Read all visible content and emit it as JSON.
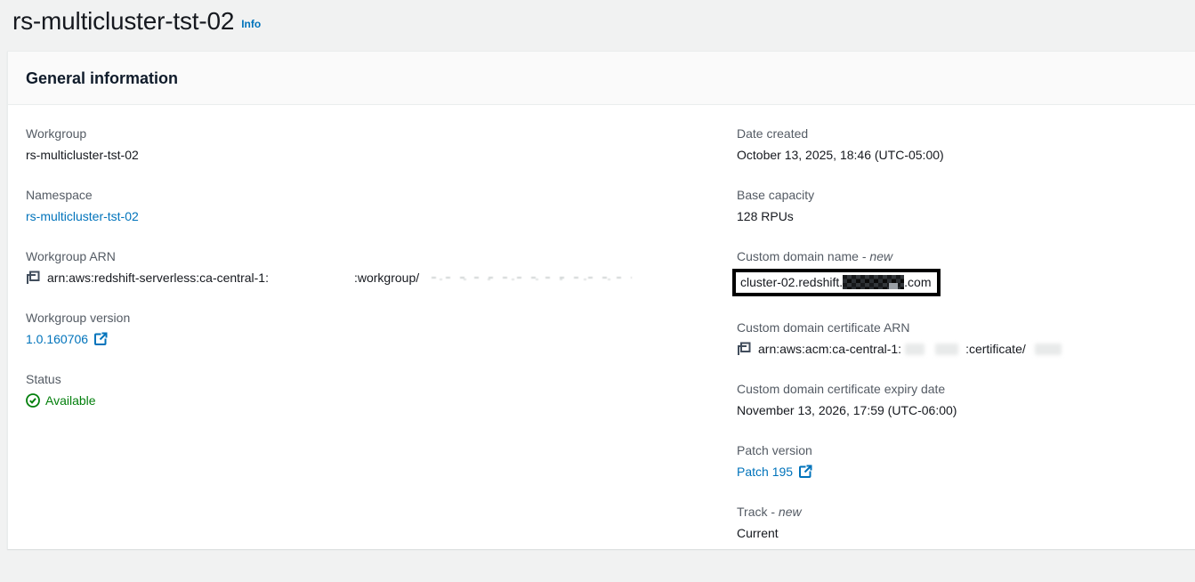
{
  "page": {
    "title": "rs-multicluster-tst-02",
    "info_link": "Info"
  },
  "panel": {
    "header": "General information"
  },
  "fields": {
    "workgroup": {
      "label": "Workgroup",
      "value": "rs-multicluster-tst-02"
    },
    "namespace": {
      "label": "Namespace",
      "value": "rs-multicluster-tst-02"
    },
    "workgroup_arn": {
      "label": "Workgroup ARN",
      "value_prefix": "arn:aws:redshift-serverless:ca-central-1:",
      "value_mid": ":workgroup/"
    },
    "workgroup_version": {
      "label": "Workgroup version",
      "value": "1.0.160706"
    },
    "status": {
      "label": "Status",
      "value": "Available"
    },
    "date_created": {
      "label": "Date created",
      "value": "October 13, 2025, 18:46 (UTC-05:00)"
    },
    "base_capacity": {
      "label": "Base capacity",
      "value": "128 RPUs"
    },
    "custom_domain_name": {
      "label": "Custom domain name - ",
      "label_suffix": "new",
      "value_prefix": "cluster-02.redshift.",
      "value_suffix": ".com"
    },
    "custom_domain_cert_arn": {
      "label": "Custom domain certificate ARN",
      "value_prefix": "arn:aws:acm:ca-central-1:",
      "value_mid": ":certificate/"
    },
    "cert_expiry": {
      "label": "Custom domain certificate expiry date",
      "value": "November 13, 2026, 17:59 (UTC-06:00)"
    },
    "patch_version": {
      "label": "Patch version",
      "value": "Patch 195"
    },
    "track": {
      "label": "Track - ",
      "label_suffix": "new",
      "value": "Current"
    }
  },
  "colors": {
    "link_blue": "#0073bb",
    "status_green": "#037f0c",
    "label_gray": "#545b64",
    "text_dark": "#16191f",
    "panel_header_bg": "#fafafa",
    "page_bg": "#f1f2f2"
  }
}
